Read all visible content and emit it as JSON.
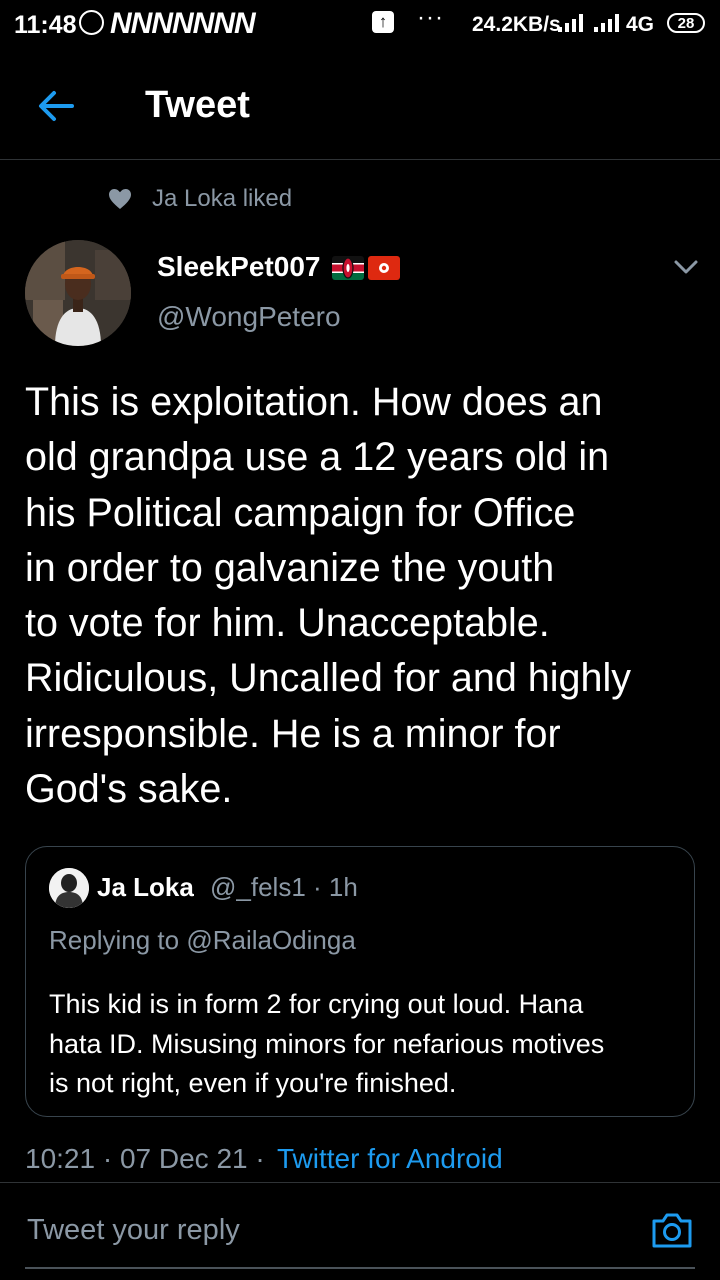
{
  "status_bar": {
    "time": "11:48",
    "notification_letters": "NNNNNNN",
    "overflow_dots": "···",
    "network_speed": "24.2KB/s",
    "network_type": "4G",
    "battery": "28"
  },
  "header": {
    "title": "Tweet",
    "back_icon": "arrow-left-icon"
  },
  "social_context": {
    "icon": "heart-icon",
    "text": "Ja Loka liked"
  },
  "author": {
    "name": "SleekPet007",
    "flags": [
      "Kenya flag",
      "Hong Kong flag"
    ],
    "handle": "@WongPetero"
  },
  "tweet": {
    "text": "This is exploitation. How does an\nold grandpa use a 12 years old in\nhis Political campaign for Office\nin order to galvanize the youth\nto vote for him. Unacceptable.\nRidiculous, Uncalled for and highly\nirresponsible. He is a minor for\nGod's sake.",
    "timestamp": "10:21 · 07 Dec 21 ·",
    "source": "Twitter for Android"
  },
  "quoted_tweet": {
    "name": "Ja Loka",
    "handle_time": "@_fels1 · 1h",
    "replying_prefix": "Replying to",
    "replying_handle": "@RailaOdinga",
    "text": "This kid is in form 2 for crying out loud. Hana\nhata ID. Misusing minors for nefarious motives\nis not right, even if you're finished."
  },
  "reply": {
    "placeholder": "Tweet your reply",
    "camera_icon": "camera-icon"
  },
  "colors": {
    "background": "#000000",
    "secondary_text": "#8b98a5",
    "accent": "#1d9bf0",
    "divider": "#2f3336"
  }
}
